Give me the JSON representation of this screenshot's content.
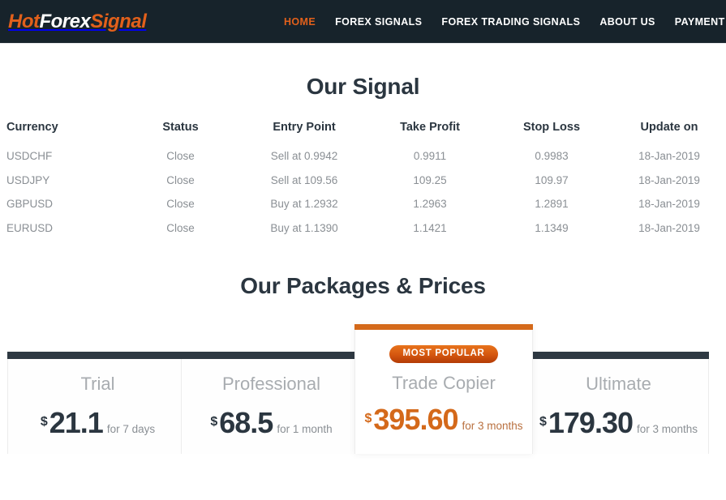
{
  "header": {
    "logo": {
      "hot": "Hot",
      "forex": "Forex",
      "signal": "Signal"
    },
    "nav": [
      {
        "label": "HOME",
        "active": true
      },
      {
        "label": "FOREX SIGNALS",
        "active": false
      },
      {
        "label": "FOREX TRADING SIGNALS",
        "active": false
      },
      {
        "label": "ABOUT US",
        "active": false
      },
      {
        "label": "PAYMENT WAYS",
        "active": false
      }
    ]
  },
  "signal": {
    "title": "Our Signal",
    "columns": [
      "Currency",
      "Status",
      "Entry Point",
      "Take Profit",
      "Stop Loss",
      "Update on"
    ],
    "rows": [
      {
        "currency": "USDCHF",
        "status": "Close",
        "entry": "Sell at 0.9942",
        "take_profit": "0.9911",
        "stop_loss": "0.9983",
        "updated": "18-Jan-2019"
      },
      {
        "currency": "USDJPY",
        "status": "Close",
        "entry": "Sell at 109.56",
        "take_profit": "109.25",
        "stop_loss": "109.97",
        "updated": "18-Jan-2019"
      },
      {
        "currency": "GBPUSD",
        "status": "Close",
        "entry": "Buy at 1.2932",
        "take_profit": "1.2963",
        "stop_loss": "1.2891",
        "updated": "18-Jan-2019"
      },
      {
        "currency": "EURUSD",
        "status": "Close",
        "entry": "Buy at 1.1390",
        "take_profit": "1.1421",
        "stop_loss": "1.1349",
        "updated": "18-Jan-2019"
      }
    ]
  },
  "packages": {
    "title": "Our Packages & Prices",
    "badge_label": "MOST POPULAR",
    "currency_symbol": "$",
    "plans": [
      {
        "name": "Trial",
        "price": "21.1",
        "period": "for 7 days",
        "featured": false
      },
      {
        "name": "Professional",
        "price": "68.5",
        "period": "for 1 month",
        "featured": false
      },
      {
        "name": "Trade Copier",
        "price": "395.60",
        "period": "for 3 months",
        "featured": true
      },
      {
        "name": "Ultimate",
        "price": "179.30",
        "period": "for 3 months",
        "featured": false
      }
    ]
  },
  "colors": {
    "header_bg": "#17232b",
    "accent_orange": "#e2601b",
    "featured_orange": "#d4691a",
    "dark_navy": "#2b3640",
    "muted_text": "#8a8f94"
  }
}
